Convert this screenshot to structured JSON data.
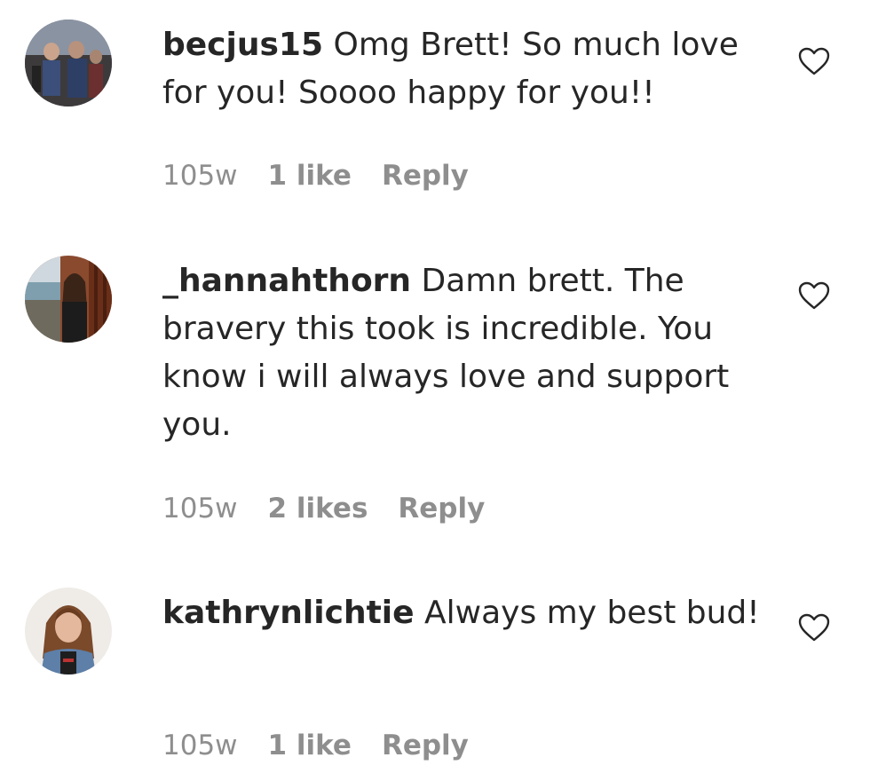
{
  "comments": [
    {
      "username": "becjus15",
      "text": "Omg Brett! So much love for you! Soooo happy for you!!",
      "time": "105w",
      "likes": "1 like",
      "reply": "Reply",
      "avatar_icon": "user-avatar-crowd-photo",
      "like_icon": "heart-outline-icon"
    },
    {
      "username": "_hannahthorn",
      "text": "Damn brett. The bravery this took is incredible. You know i will always love and support you.",
      "time": "105w",
      "likes": "2 likes",
      "reply": "Reply",
      "avatar_icon": "user-avatar-window-photo",
      "like_icon": "heart-outline-icon"
    },
    {
      "username": "kathrynlichtie",
      "text": "Always my best bud!",
      "time": "105w",
      "likes": "1 like",
      "reply": "Reply",
      "avatar_icon": "user-avatar-portrait-photo",
      "like_icon": "heart-outline-icon"
    }
  ],
  "colors": {
    "text": "#262626",
    "secondary": "#8e8e8e",
    "background": "#ffffff"
  }
}
